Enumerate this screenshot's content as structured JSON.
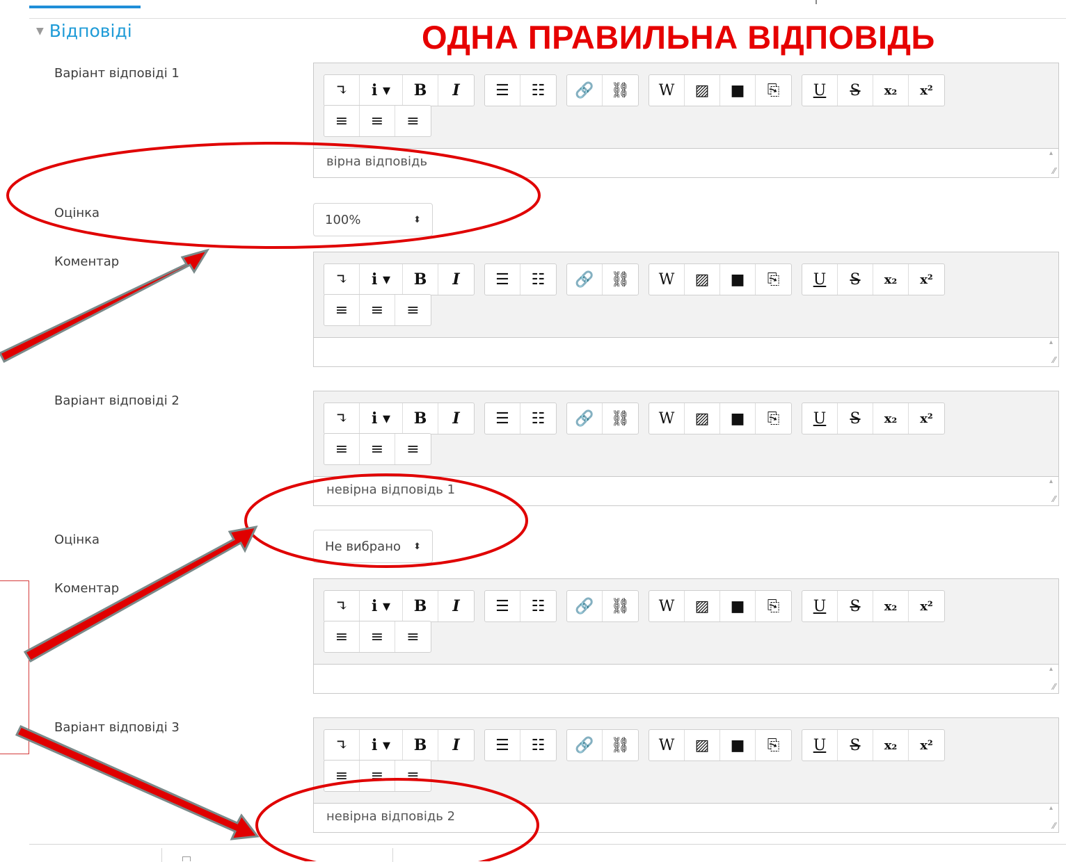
{
  "section": {
    "title": "Відповіді"
  },
  "annotation": {
    "text": "ОДНА ПРАВИЛЬНА ВІДПОВІДЬ"
  },
  "labels": {
    "answer1": "Варіант відповіді 1",
    "grade1": "Оцінка",
    "feedback1": "Коментар",
    "answer2": "Варіант відповіді 2",
    "grade2": "Оцінка",
    "feedback2": "Коментар",
    "answer3": "Варіант відповіді 3"
  },
  "editors": {
    "answer1_text": "вірна відповідь",
    "feedback1_text": "",
    "answer2_text": "невірна відповідь 1",
    "feedback2_text": "",
    "answer3_text": "невірна відповідь 2"
  },
  "grades": {
    "grade1": "100%",
    "grade2": "Не вибрано"
  },
  "toolbar": {
    "row1": [
      [
        "toggle-toolbar-icon",
        "info-dropdown-icon",
        "bold-icon",
        "italic-icon"
      ],
      [
        "unordered-list-icon",
        "ordered-list-icon"
      ],
      [
        "link-icon",
        "unlink-icon"
      ],
      [
        "insert-word-icon",
        "insert-image-icon",
        "insert-media-icon",
        "manage-files-icon"
      ],
      [
        "underline-icon",
        "strikethrough-icon",
        "subscript-icon",
        "superscript-icon"
      ]
    ],
    "row2": [
      [
        "align-left-icon",
        "align-center-icon",
        "align-right-icon"
      ]
    ],
    "glyphs": {
      "toggle-toolbar-icon": "↴",
      "info-dropdown-icon": "i ▾",
      "bold-icon": "B",
      "italic-icon": "I",
      "unordered-list-icon": "☰",
      "ordered-list-icon": "☷",
      "link-icon": "🔗",
      "unlink-icon": "⛓",
      "insert-word-icon": "W",
      "insert-image-icon": "▨",
      "insert-media-icon": "■",
      "manage-files-icon": "⎘",
      "underline-icon": "U",
      "strikethrough-icon": "S",
      "subscript-icon": "x₂",
      "superscript-icon": "x²",
      "align-left-icon": "≡",
      "align-center-icon": "≡",
      "align-right-icon": "≡"
    }
  },
  "colors": {
    "accent": "#1e9bd7",
    "annotation_red": "#e60000",
    "arrow_fill": "#e00000",
    "arrow_outline": "#7a8a8a"
  },
  "icons": {
    "section_toggle": "▼",
    "select_arrow": "⬍",
    "resize": "⁄⁄"
  }
}
